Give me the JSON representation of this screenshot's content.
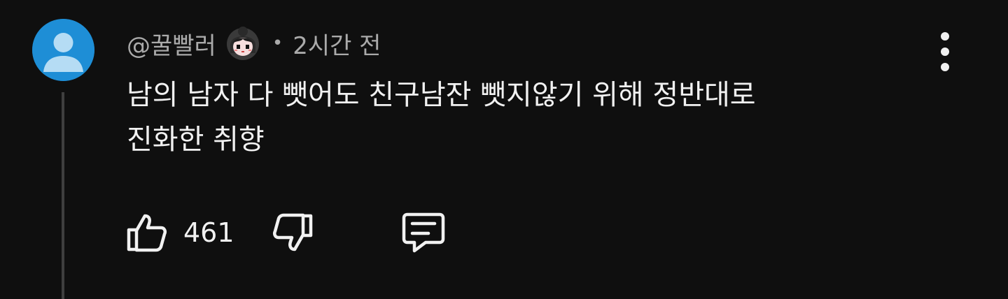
{
  "comment": {
    "author": "@꿀빨러",
    "separator": "•",
    "timestamp": "2시간 전",
    "text": "남의 남자 다 뺏어도 친구남잔 뺏지않기 위해 정반대로\n진화한 취향",
    "likes": "461",
    "avatar_color": "#1e8ed6",
    "icons": {
      "more": "more-vert-icon",
      "like": "thumbs-up-icon",
      "dislike": "thumbs-down-icon",
      "reply": "reply-comment-icon",
      "badge": "member-badge-icon"
    }
  }
}
